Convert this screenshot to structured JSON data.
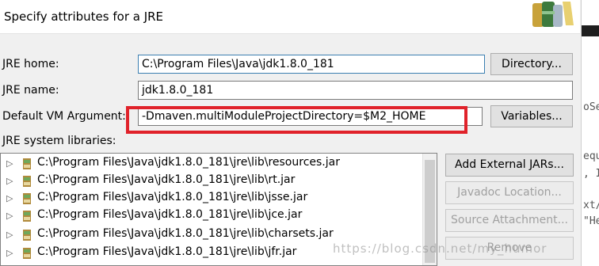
{
  "dialog": {
    "title": "Specify attributes for a JRE"
  },
  "form": {
    "jre_home_label": "JRE home:",
    "jre_home_value": "C:\\Program Files\\Java\\jdk1.8.0_181",
    "jre_name_label": "JRE name:",
    "jre_name_value": "jdk1.8.0_181",
    "vm_args_label": "Default VM Argument:",
    "vm_args_value": "-Dmaven.multiModuleProjectDirectory=$M2_HOME",
    "libraries_label": "JRE system libraries:"
  },
  "buttons": {
    "directory": "Directory...",
    "variables": "Variables...",
    "add_external_jars": "Add External JARs...",
    "javadoc_location": "Javadoc Location...",
    "source_attachment": "Source Attachment...",
    "remove": "Remove"
  },
  "libraries": [
    "C:\\Program Files\\Java\\jdk1.8.0_181\\jre\\lib\\resources.jar",
    "C:\\Program Files\\Java\\jdk1.8.0_181\\jre\\lib\\rt.jar",
    "C:\\Program Files\\Java\\jdk1.8.0_181\\jre\\lib\\jsse.jar",
    "C:\\Program Files\\Java\\jdk1.8.0_181\\jre\\lib\\jce.jar",
    "C:\\Program Files\\Java\\jdk1.8.0_181\\jre\\lib\\charsets.jar",
    "C:\\Program Files\\Java\\jdk1.8.0_181\\jre\\lib\\jfr.jar"
  ],
  "background_fragments": [
    "oSe",
    "equ",
    ", I",
    "xt/",
    "\"He"
  ],
  "watermark": "https://blog.csdn.net/my_humor",
  "colors": {
    "highlight": "#e0222a"
  }
}
